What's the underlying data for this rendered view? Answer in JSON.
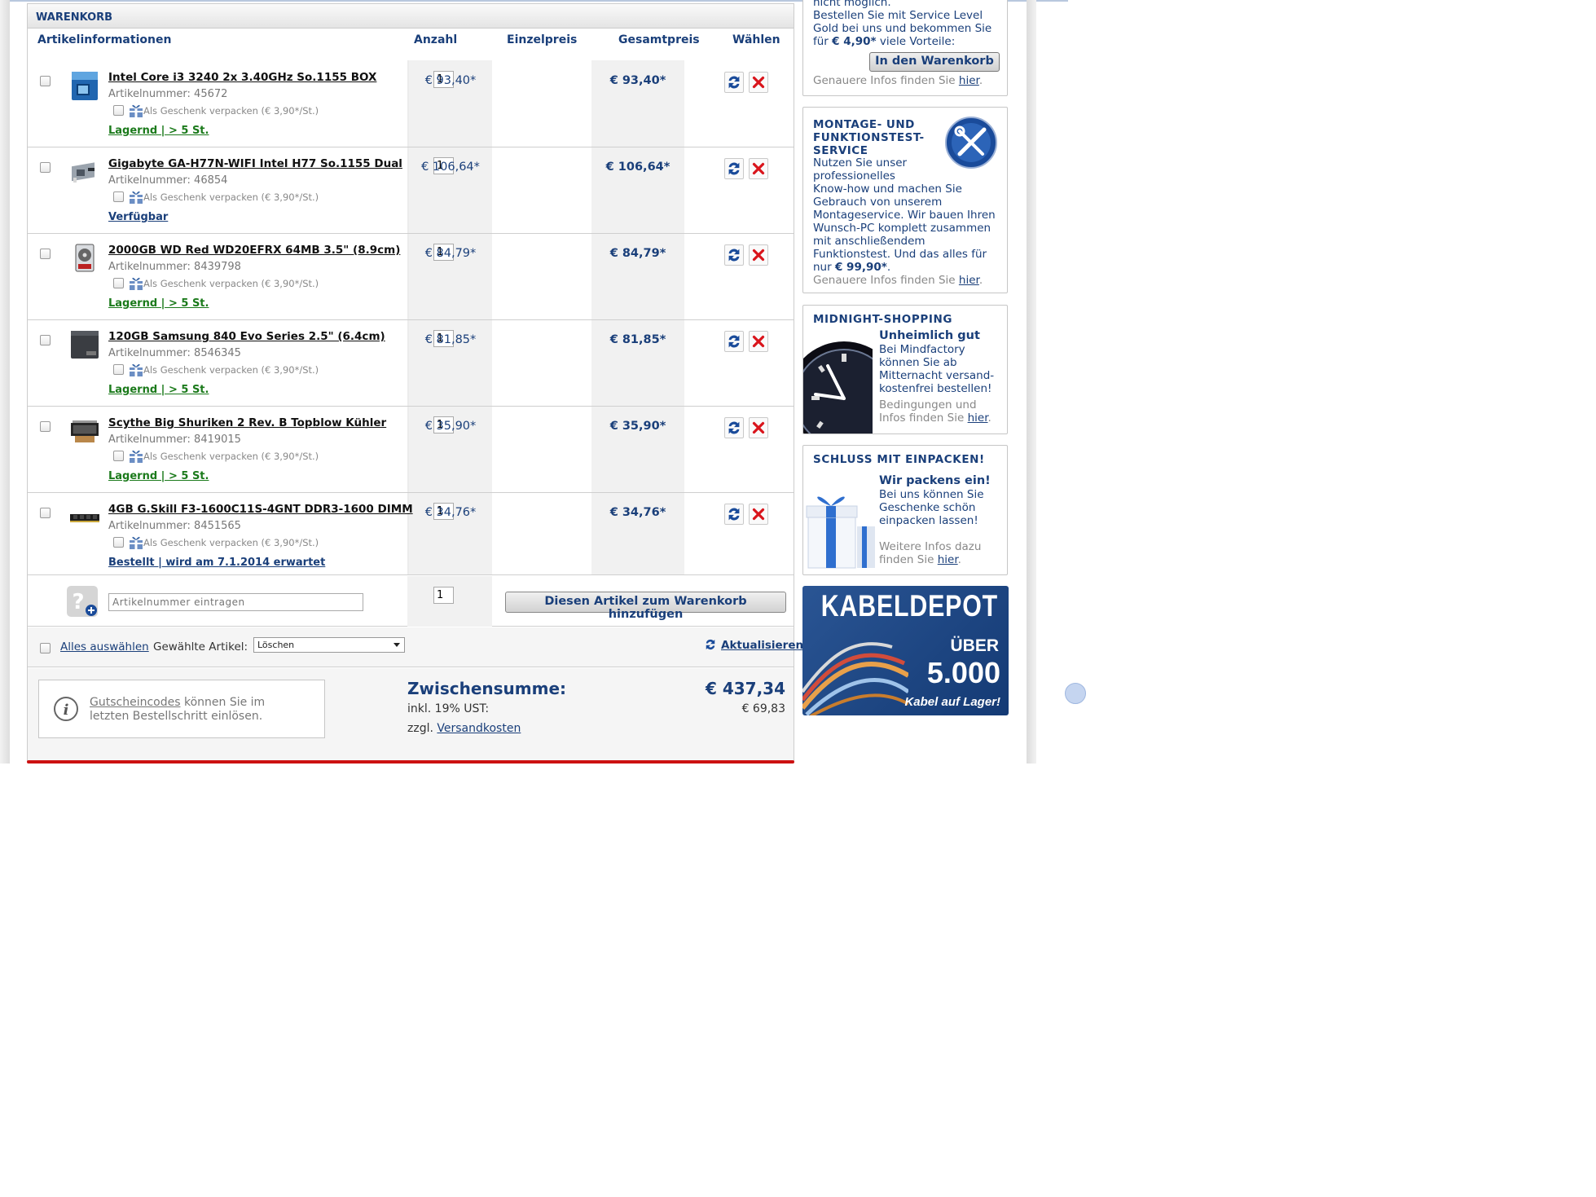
{
  "cart": {
    "title": "WARENKORB",
    "columns": {
      "info": "Artikelinformationen",
      "qty": "Anzahl",
      "unit": "Einzelpreis",
      "total": "Gesamtpreis",
      "select": "Wählen"
    },
    "gift_label": "Als Geschenk verpacken (€ 3,90*/St.)",
    "items": [
      {
        "name": "Intel Core i3 3240 2x 3.40GHz So.1155 BOX",
        "artnr": "Artikelnummer: 45672",
        "stock": "Lagernd | > 5 St.",
        "stock_color": "#1b7a1b",
        "qty": "1",
        "unit_price": "€ 93,40*",
        "total_price": "€ 93,40*"
      },
      {
        "name": "Gigabyte GA-H77N-WIFI Intel H77 So.1155 Dual",
        "artnr": "Artikelnummer: 46854",
        "stock": "Verfügbar",
        "stock_color": "#1a3f7a",
        "qty": "1",
        "unit_price": "€ 106,64*",
        "total_price": "€ 106,64*"
      },
      {
        "name": "2000GB WD Red WD20EFRX 64MB 3.5\" (8.9cm)",
        "artnr": "Artikelnummer: 8439798",
        "stock": "Lagernd | > 5 St.",
        "stock_color": "#1b7a1b",
        "qty": "1",
        "unit_price": "€ 84,79*",
        "total_price": "€ 84,79*"
      },
      {
        "name": "120GB Samsung 840 Evo Series 2.5\" (6.4cm)",
        "artnr": "Artikelnummer: 8546345",
        "stock": "Lagernd | > 5 St.",
        "stock_color": "#1b7a1b",
        "qty": "1",
        "unit_price": "€ 81,85*",
        "total_price": "€ 81,85*"
      },
      {
        "name": "Scythe Big Shuriken 2 Rev. B Topblow Kühler",
        "artnr": "Artikelnummer: 8419015",
        "stock": "Lagernd | > 5 St.",
        "stock_color": "#1b7a1b",
        "qty": "1",
        "unit_price": "€ 35,90*",
        "total_price": "€ 35,90*"
      },
      {
        "name": "4GB G.Skill F3-1600C11S-4GNT DDR3-1600 DIMM",
        "artnr": "Artikelnummer: 8451565",
        "stock": "Bestellt | wird am 7.1.2014 erwartet",
        "stock_color": "#1a3f7a",
        "qty": "1",
        "unit_price": "€ 34,76*",
        "total_price": "€ 34,76*"
      }
    ],
    "add": {
      "placeholder": "Artikelnummer eintragen",
      "qty": "1",
      "button": "Diesen Artikel zum Warenkorb hinzufügen"
    },
    "select_all": "Alles auswählen",
    "selected_label": "Gewählte Artikel:",
    "selected_option": "Löschen",
    "refresh": "Aktualisieren",
    "coupon": {
      "link": "Gutscheincodes",
      "text1": "können Sie im",
      "text2": "letzten Bestellschritt einlösen."
    },
    "subtotal_label": "Zwischensumme:",
    "subtotal_value": "€ 437,34",
    "vat_label": "inkl. 19% UST:",
    "vat_value": "€ 69,83",
    "shipping_prefix": "zzgl.",
    "shipping_link": "Versandkosten"
  },
  "sidebar": {
    "service": {
      "line0": "nicht möglich.",
      "line1": "Bestellen Sie mit Service Level",
      "line2": "Gold bei uns und bekommen Sie",
      "line3_pre": "für",
      "line3_price": "€ 4,90*",
      "line3_post": "viele Vorteile:",
      "button": "In den Warenkorb",
      "info": "Genauere Infos finden Sie",
      "link": "hier"
    },
    "montage": {
      "title1": "MONTAGE- UND",
      "title2": "FUNKTIONSTEST-",
      "title3": "SERVICE",
      "l1": "Nutzen Sie unser",
      "l2": "professionelles",
      "l3": "Know-how und machen Sie",
      "l4": "Gebrauch von unserem",
      "l5": "Montageservice. Wir bauen Ihren",
      "l6": "Wunsch-PC komplett zusammen",
      "l7": "mit anschließendem",
      "l8": "Funktionstest. Und das alles für",
      "l9_pre": "nur",
      "l9_price": "€ 99,90*",
      "info": "Genauere Infos finden Sie",
      "link": "hier"
    },
    "midnight": {
      "title": "MIDNIGHT-SHOPPING",
      "sub": "Unheimlich gut",
      "l1": "Bei Mindfactory",
      "l2": "können Sie ab",
      "l3": "Mitternacht versand-",
      "l4": "kostenfrei bestellen!",
      "m1": "Bedingungen und",
      "m2": "Infos finden Sie",
      "link": "hier"
    },
    "gift": {
      "title": "SCHLUSS MIT EINPACKEN!",
      "sub": "Wir packens ein!",
      "l1": "Bei uns können Sie",
      "l2": "Geschenke schön",
      "l3": "einpacken lassen!",
      "m1": "Weitere Infos dazu",
      "m2": "finden Sie",
      "link": "hier"
    },
    "kabel": {
      "title": "KABELDEPOT",
      "over": "ÜBER",
      "count": "5.000",
      "sub": "Kabel auf Lager!"
    }
  },
  "colors": {
    "brand_blue": "#1a3f7a",
    "stock_green": "#1b7a1b",
    "delete_red": "#d9141b",
    "bottom_red": "#cc1111"
  }
}
